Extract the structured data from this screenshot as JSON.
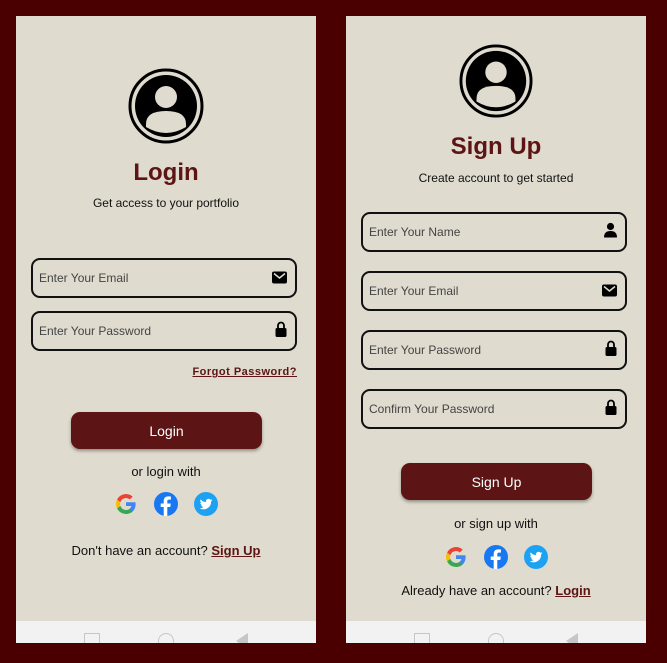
{
  "login_screen": {
    "title": "Login",
    "subtitle": "Get access to your portfolio",
    "email_placeholder": "Enter Your Email",
    "password_placeholder": "Enter Your Password",
    "forgot_password": "Forgot Password?",
    "login_button": "Login",
    "alt_text": "or login with",
    "footer_text": "Don't have an account?",
    "footer_link": "Sign Up"
  },
  "signup_screen": {
    "title": "Sign Up",
    "subtitle": "Create account to get started",
    "name_placeholder": "Enter Your Name",
    "email_placeholder": "Enter Your Email",
    "password_placeholder": "Enter Your Password",
    "confirm_placeholder": "Confirm Your Password",
    "signup_button": "Sign Up",
    "alt_text": "or sign up with",
    "footer_text": "Already have an account?",
    "footer_link": "Login"
  },
  "colors": {
    "background": "#4a0000",
    "screen": "#e0dbcf",
    "accent": "#5c1414"
  },
  "icons": [
    "avatar-icon",
    "mail-icon",
    "lock-icon",
    "person-icon",
    "google-icon",
    "facebook-icon",
    "twitter-icon"
  ]
}
